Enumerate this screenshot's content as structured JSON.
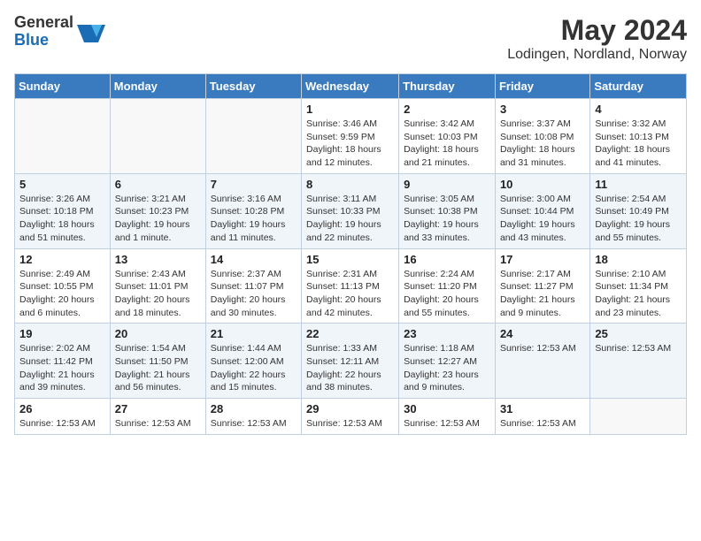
{
  "header": {
    "logo_general": "General",
    "logo_blue": "Blue",
    "month_year": "May 2024",
    "location": "Lodingen, Nordland, Norway"
  },
  "weekdays": [
    "Sunday",
    "Monday",
    "Tuesday",
    "Wednesday",
    "Thursday",
    "Friday",
    "Saturday"
  ],
  "weeks": [
    [
      {
        "day": "",
        "sunrise": "",
        "sunset": "",
        "daylight": ""
      },
      {
        "day": "",
        "sunrise": "",
        "sunset": "",
        "daylight": ""
      },
      {
        "day": "",
        "sunrise": "",
        "sunset": "",
        "daylight": ""
      },
      {
        "day": "1",
        "sunrise": "Sunrise: 3:46 AM",
        "sunset": "Sunset: 9:59 PM",
        "daylight": "Daylight: 18 hours and 12 minutes."
      },
      {
        "day": "2",
        "sunrise": "Sunrise: 3:42 AM",
        "sunset": "Sunset: 10:03 PM",
        "daylight": "Daylight: 18 hours and 21 minutes."
      },
      {
        "day": "3",
        "sunrise": "Sunrise: 3:37 AM",
        "sunset": "Sunset: 10:08 PM",
        "daylight": "Daylight: 18 hours and 31 minutes."
      },
      {
        "day": "4",
        "sunrise": "Sunrise: 3:32 AM",
        "sunset": "Sunset: 10:13 PM",
        "daylight": "Daylight: 18 hours and 41 minutes."
      }
    ],
    [
      {
        "day": "5",
        "sunrise": "Sunrise: 3:26 AM",
        "sunset": "Sunset: 10:18 PM",
        "daylight": "Daylight: 18 hours and 51 minutes."
      },
      {
        "day": "6",
        "sunrise": "Sunrise: 3:21 AM",
        "sunset": "Sunset: 10:23 PM",
        "daylight": "Daylight: 19 hours and 1 minute."
      },
      {
        "day": "7",
        "sunrise": "Sunrise: 3:16 AM",
        "sunset": "Sunset: 10:28 PM",
        "daylight": "Daylight: 19 hours and 11 minutes."
      },
      {
        "day": "8",
        "sunrise": "Sunrise: 3:11 AM",
        "sunset": "Sunset: 10:33 PM",
        "daylight": "Daylight: 19 hours and 22 minutes."
      },
      {
        "day": "9",
        "sunrise": "Sunrise: 3:05 AM",
        "sunset": "Sunset: 10:38 PM",
        "daylight": "Daylight: 19 hours and 33 minutes."
      },
      {
        "day": "10",
        "sunrise": "Sunrise: 3:00 AM",
        "sunset": "Sunset: 10:44 PM",
        "daylight": "Daylight: 19 hours and 43 minutes."
      },
      {
        "day": "11",
        "sunrise": "Sunrise: 2:54 AM",
        "sunset": "Sunset: 10:49 PM",
        "daylight": "Daylight: 19 hours and 55 minutes."
      }
    ],
    [
      {
        "day": "12",
        "sunrise": "Sunrise: 2:49 AM",
        "sunset": "Sunset: 10:55 PM",
        "daylight": "Daylight: 20 hours and 6 minutes."
      },
      {
        "day": "13",
        "sunrise": "Sunrise: 2:43 AM",
        "sunset": "Sunset: 11:01 PM",
        "daylight": "Daylight: 20 hours and 18 minutes."
      },
      {
        "day": "14",
        "sunrise": "Sunrise: 2:37 AM",
        "sunset": "Sunset: 11:07 PM",
        "daylight": "Daylight: 20 hours and 30 minutes."
      },
      {
        "day": "15",
        "sunrise": "Sunrise: 2:31 AM",
        "sunset": "Sunset: 11:13 PM",
        "daylight": "Daylight: 20 hours and 42 minutes."
      },
      {
        "day": "16",
        "sunrise": "Sunrise: 2:24 AM",
        "sunset": "Sunset: 11:20 PM",
        "daylight": "Daylight: 20 hours and 55 minutes."
      },
      {
        "day": "17",
        "sunrise": "Sunrise: 2:17 AM",
        "sunset": "Sunset: 11:27 PM",
        "daylight": "Daylight: 21 hours and 9 minutes."
      },
      {
        "day": "18",
        "sunrise": "Sunrise: 2:10 AM",
        "sunset": "Sunset: 11:34 PM",
        "daylight": "Daylight: 21 hours and 23 minutes."
      }
    ],
    [
      {
        "day": "19",
        "sunrise": "Sunrise: 2:02 AM",
        "sunset": "Sunset: 11:42 PM",
        "daylight": "Daylight: 21 hours and 39 minutes."
      },
      {
        "day": "20",
        "sunrise": "Sunrise: 1:54 AM",
        "sunset": "Sunset: 11:50 PM",
        "daylight": "Daylight: 21 hours and 56 minutes."
      },
      {
        "day": "21",
        "sunrise": "Sunrise: 1:44 AM",
        "sunset": "Sunset: 12:00 AM",
        "daylight": "Daylight: 22 hours and 15 minutes."
      },
      {
        "day": "22",
        "sunrise": "Sunrise: 1:33 AM",
        "sunset": "Sunset: 12:11 AM",
        "daylight": "Daylight: 22 hours and 38 minutes."
      },
      {
        "day": "23",
        "sunrise": "Sunrise: 1:18 AM",
        "sunset": "Sunset: 12:27 AM",
        "daylight": "Daylight: 23 hours and 9 minutes."
      },
      {
        "day": "24",
        "sunrise": "Sunrise: 12:53 AM",
        "sunset": "",
        "daylight": ""
      },
      {
        "day": "25",
        "sunrise": "Sunrise: 12:53 AM",
        "sunset": "",
        "daylight": ""
      }
    ],
    [
      {
        "day": "26",
        "sunrise": "Sunrise: 12:53 AM",
        "sunset": "",
        "daylight": ""
      },
      {
        "day": "27",
        "sunrise": "Sunrise: 12:53 AM",
        "sunset": "",
        "daylight": ""
      },
      {
        "day": "28",
        "sunrise": "Sunrise: 12:53 AM",
        "sunset": "",
        "daylight": ""
      },
      {
        "day": "29",
        "sunrise": "Sunrise: 12:53 AM",
        "sunset": "",
        "daylight": ""
      },
      {
        "day": "30",
        "sunrise": "Sunrise: 12:53 AM",
        "sunset": "",
        "daylight": ""
      },
      {
        "day": "31",
        "sunrise": "Sunrise: 12:53 AM",
        "sunset": "",
        "daylight": ""
      },
      {
        "day": "",
        "sunrise": "",
        "sunset": "",
        "daylight": ""
      }
    ]
  ]
}
